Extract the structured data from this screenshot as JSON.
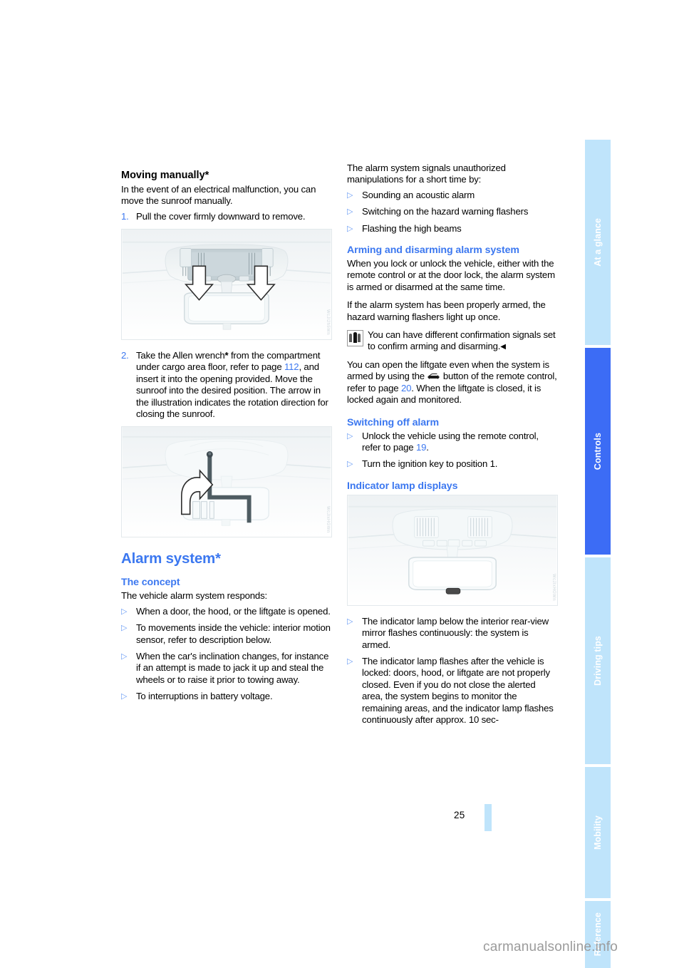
{
  "document": {
    "page_number": "25",
    "watermark": "carmanualsonline.info"
  },
  "sidebar": {
    "tabs": [
      {
        "label": "At a glance",
        "active": false
      },
      {
        "label": "Controls",
        "active": true
      },
      {
        "label": "Driving tips",
        "active": false
      },
      {
        "label": "Mobility",
        "active": false
      },
      {
        "label": "Reference",
        "active": false
      }
    ]
  },
  "left_column": {
    "heading_moving": "Moving manually*",
    "intro": "In the event of an electrical malfunction, you can move the sunroof manually.",
    "step1_num": "1.",
    "step1_text": "Pull the cover firmly downward to remove.",
    "figure1_code": "WcJI2h5Wn",
    "step2_num": "2.",
    "step2_text_a": "Take the Allen wrench",
    "step2_star": "*",
    "step2_text_b": " from the compartment under cargo area floor, refer to page ",
    "step2_page_ref": "112",
    "step2_text_c": ", and insert it into the opening provided. Move the sunroof into the desired position. The arrow in the illustration indicates the rotation direction for closing the sunroof.",
    "figure2_code": "WcJlxHGWn",
    "heading_alarm": "Alarm system*",
    "heading_concept": "The concept",
    "concept_intro": "The vehicle alarm system responds:",
    "concept_bullets": [
      "When a door, the hood, or the liftgate is opened.",
      "To movements inside the vehicle: interior motion sensor, refer to description below.",
      "When the car's inclination changes, for instance if an attempt is made to jack it up and steal the wheels or to raise it prior to towing away.",
      "To interruptions in battery voltage."
    ]
  },
  "right_column": {
    "signals_intro": "The alarm system signals unauthorized manipulations for a short time by:",
    "signals_bullets": [
      "Sounding an acoustic alarm",
      "Switching on the hazard warning flashers",
      "Flashing the high beams"
    ],
    "heading_arming": "Arming and disarming alarm system",
    "arming_p1": "When you lock or unlock the vehicle, either with the remote control or at the door lock, the alarm system is armed or disarmed at the same time.",
    "arming_p2": "If the alarm system has been properly armed, the hazard warning flashers light up once.",
    "note_text": "You can have different confirmation signals set to confirm arming and disarming.",
    "note_end_marker": "◀",
    "liftgate_text_a": "You can open the liftgate even when the system is armed by using the ",
    "liftgate_text_b": " button of the remote control, refer to page ",
    "liftgate_page_ref": "20",
    "liftgate_text_c": ". When the liftgate is closed, it is locked again and monitored.",
    "heading_switching_off": "Switching off alarm",
    "switch_off_bullet1_a": "Unlock the vehicle using the remote control, refer to page ",
    "switch_off_bullet1_ref": "19",
    "switch_off_bullet1_b": ".",
    "switch_off_bullet2": "Turn the ignition key to position 1.",
    "heading_indicator": "Indicator lamp displays",
    "figure3_code": "WcJIxHGWn",
    "indicator_bullets": [
      "The indicator lamp below the interior rear-view mirror flashes continuously: the system is armed.",
      "The indicator lamp flashes after the vehicle is locked: doors, hood, or liftgate are not properly closed. Even if you do not close the alerted area, the system begins to monitor the remaining areas, and the indicator lamp flashes continuously after approx. 10 sec-"
    ]
  },
  "colors": {
    "accent_blue": "#3c78f0",
    "tab_active": "#3c6cf5",
    "tab_inactive": "#bfe4fb"
  }
}
